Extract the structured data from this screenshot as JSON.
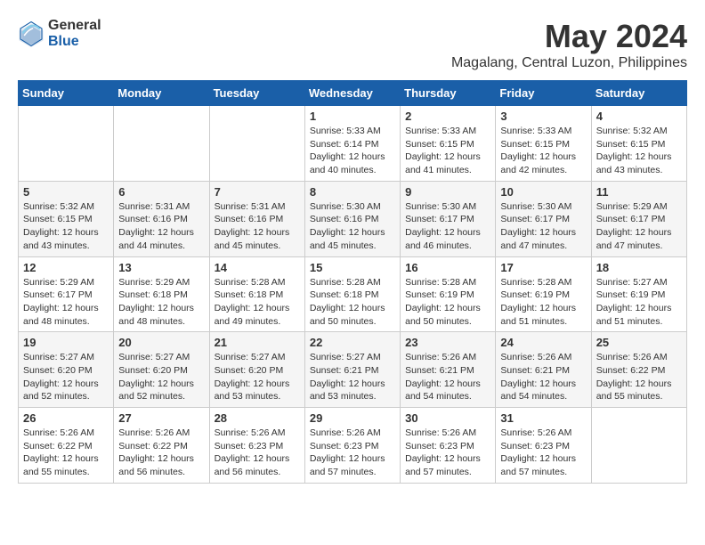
{
  "header": {
    "logo_general": "General",
    "logo_blue": "Blue",
    "month_title": "May 2024",
    "location": "Magalang, Central Luzon, Philippines"
  },
  "weekdays": [
    "Sunday",
    "Monday",
    "Tuesday",
    "Wednesday",
    "Thursday",
    "Friday",
    "Saturday"
  ],
  "weeks": [
    {
      "row_class": "odd-row",
      "days": [
        {
          "num": "",
          "info": ""
        },
        {
          "num": "",
          "info": ""
        },
        {
          "num": "",
          "info": ""
        },
        {
          "num": "1",
          "info": "Sunrise: 5:33 AM\nSunset: 6:14 PM\nDaylight: 12 hours\nand 40 minutes."
        },
        {
          "num": "2",
          "info": "Sunrise: 5:33 AM\nSunset: 6:15 PM\nDaylight: 12 hours\nand 41 minutes."
        },
        {
          "num": "3",
          "info": "Sunrise: 5:33 AM\nSunset: 6:15 PM\nDaylight: 12 hours\nand 42 minutes."
        },
        {
          "num": "4",
          "info": "Sunrise: 5:32 AM\nSunset: 6:15 PM\nDaylight: 12 hours\nand 43 minutes."
        }
      ]
    },
    {
      "row_class": "even-row",
      "days": [
        {
          "num": "5",
          "info": "Sunrise: 5:32 AM\nSunset: 6:15 PM\nDaylight: 12 hours\nand 43 minutes."
        },
        {
          "num": "6",
          "info": "Sunrise: 5:31 AM\nSunset: 6:16 PM\nDaylight: 12 hours\nand 44 minutes."
        },
        {
          "num": "7",
          "info": "Sunrise: 5:31 AM\nSunset: 6:16 PM\nDaylight: 12 hours\nand 45 minutes."
        },
        {
          "num": "8",
          "info": "Sunrise: 5:30 AM\nSunset: 6:16 PM\nDaylight: 12 hours\nand 45 minutes."
        },
        {
          "num": "9",
          "info": "Sunrise: 5:30 AM\nSunset: 6:17 PM\nDaylight: 12 hours\nand 46 minutes."
        },
        {
          "num": "10",
          "info": "Sunrise: 5:30 AM\nSunset: 6:17 PM\nDaylight: 12 hours\nand 47 minutes."
        },
        {
          "num": "11",
          "info": "Sunrise: 5:29 AM\nSunset: 6:17 PM\nDaylight: 12 hours\nand 47 minutes."
        }
      ]
    },
    {
      "row_class": "odd-row",
      "days": [
        {
          "num": "12",
          "info": "Sunrise: 5:29 AM\nSunset: 6:17 PM\nDaylight: 12 hours\nand 48 minutes."
        },
        {
          "num": "13",
          "info": "Sunrise: 5:29 AM\nSunset: 6:18 PM\nDaylight: 12 hours\nand 48 minutes."
        },
        {
          "num": "14",
          "info": "Sunrise: 5:28 AM\nSunset: 6:18 PM\nDaylight: 12 hours\nand 49 minutes."
        },
        {
          "num": "15",
          "info": "Sunrise: 5:28 AM\nSunset: 6:18 PM\nDaylight: 12 hours\nand 50 minutes."
        },
        {
          "num": "16",
          "info": "Sunrise: 5:28 AM\nSunset: 6:19 PM\nDaylight: 12 hours\nand 50 minutes."
        },
        {
          "num": "17",
          "info": "Sunrise: 5:28 AM\nSunset: 6:19 PM\nDaylight: 12 hours\nand 51 minutes."
        },
        {
          "num": "18",
          "info": "Sunrise: 5:27 AM\nSunset: 6:19 PM\nDaylight: 12 hours\nand 51 minutes."
        }
      ]
    },
    {
      "row_class": "even-row",
      "days": [
        {
          "num": "19",
          "info": "Sunrise: 5:27 AM\nSunset: 6:20 PM\nDaylight: 12 hours\nand 52 minutes."
        },
        {
          "num": "20",
          "info": "Sunrise: 5:27 AM\nSunset: 6:20 PM\nDaylight: 12 hours\nand 52 minutes."
        },
        {
          "num": "21",
          "info": "Sunrise: 5:27 AM\nSunset: 6:20 PM\nDaylight: 12 hours\nand 53 minutes."
        },
        {
          "num": "22",
          "info": "Sunrise: 5:27 AM\nSunset: 6:21 PM\nDaylight: 12 hours\nand 53 minutes."
        },
        {
          "num": "23",
          "info": "Sunrise: 5:26 AM\nSunset: 6:21 PM\nDaylight: 12 hours\nand 54 minutes."
        },
        {
          "num": "24",
          "info": "Sunrise: 5:26 AM\nSunset: 6:21 PM\nDaylight: 12 hours\nand 54 minutes."
        },
        {
          "num": "25",
          "info": "Sunrise: 5:26 AM\nSunset: 6:22 PM\nDaylight: 12 hours\nand 55 minutes."
        }
      ]
    },
    {
      "row_class": "odd-row",
      "days": [
        {
          "num": "26",
          "info": "Sunrise: 5:26 AM\nSunset: 6:22 PM\nDaylight: 12 hours\nand 55 minutes."
        },
        {
          "num": "27",
          "info": "Sunrise: 5:26 AM\nSunset: 6:22 PM\nDaylight: 12 hours\nand 56 minutes."
        },
        {
          "num": "28",
          "info": "Sunrise: 5:26 AM\nSunset: 6:23 PM\nDaylight: 12 hours\nand 56 minutes."
        },
        {
          "num": "29",
          "info": "Sunrise: 5:26 AM\nSunset: 6:23 PM\nDaylight: 12 hours\nand 57 minutes."
        },
        {
          "num": "30",
          "info": "Sunrise: 5:26 AM\nSunset: 6:23 PM\nDaylight: 12 hours\nand 57 minutes."
        },
        {
          "num": "31",
          "info": "Sunrise: 5:26 AM\nSunset: 6:23 PM\nDaylight: 12 hours\nand 57 minutes."
        },
        {
          "num": "",
          "info": ""
        }
      ]
    }
  ]
}
